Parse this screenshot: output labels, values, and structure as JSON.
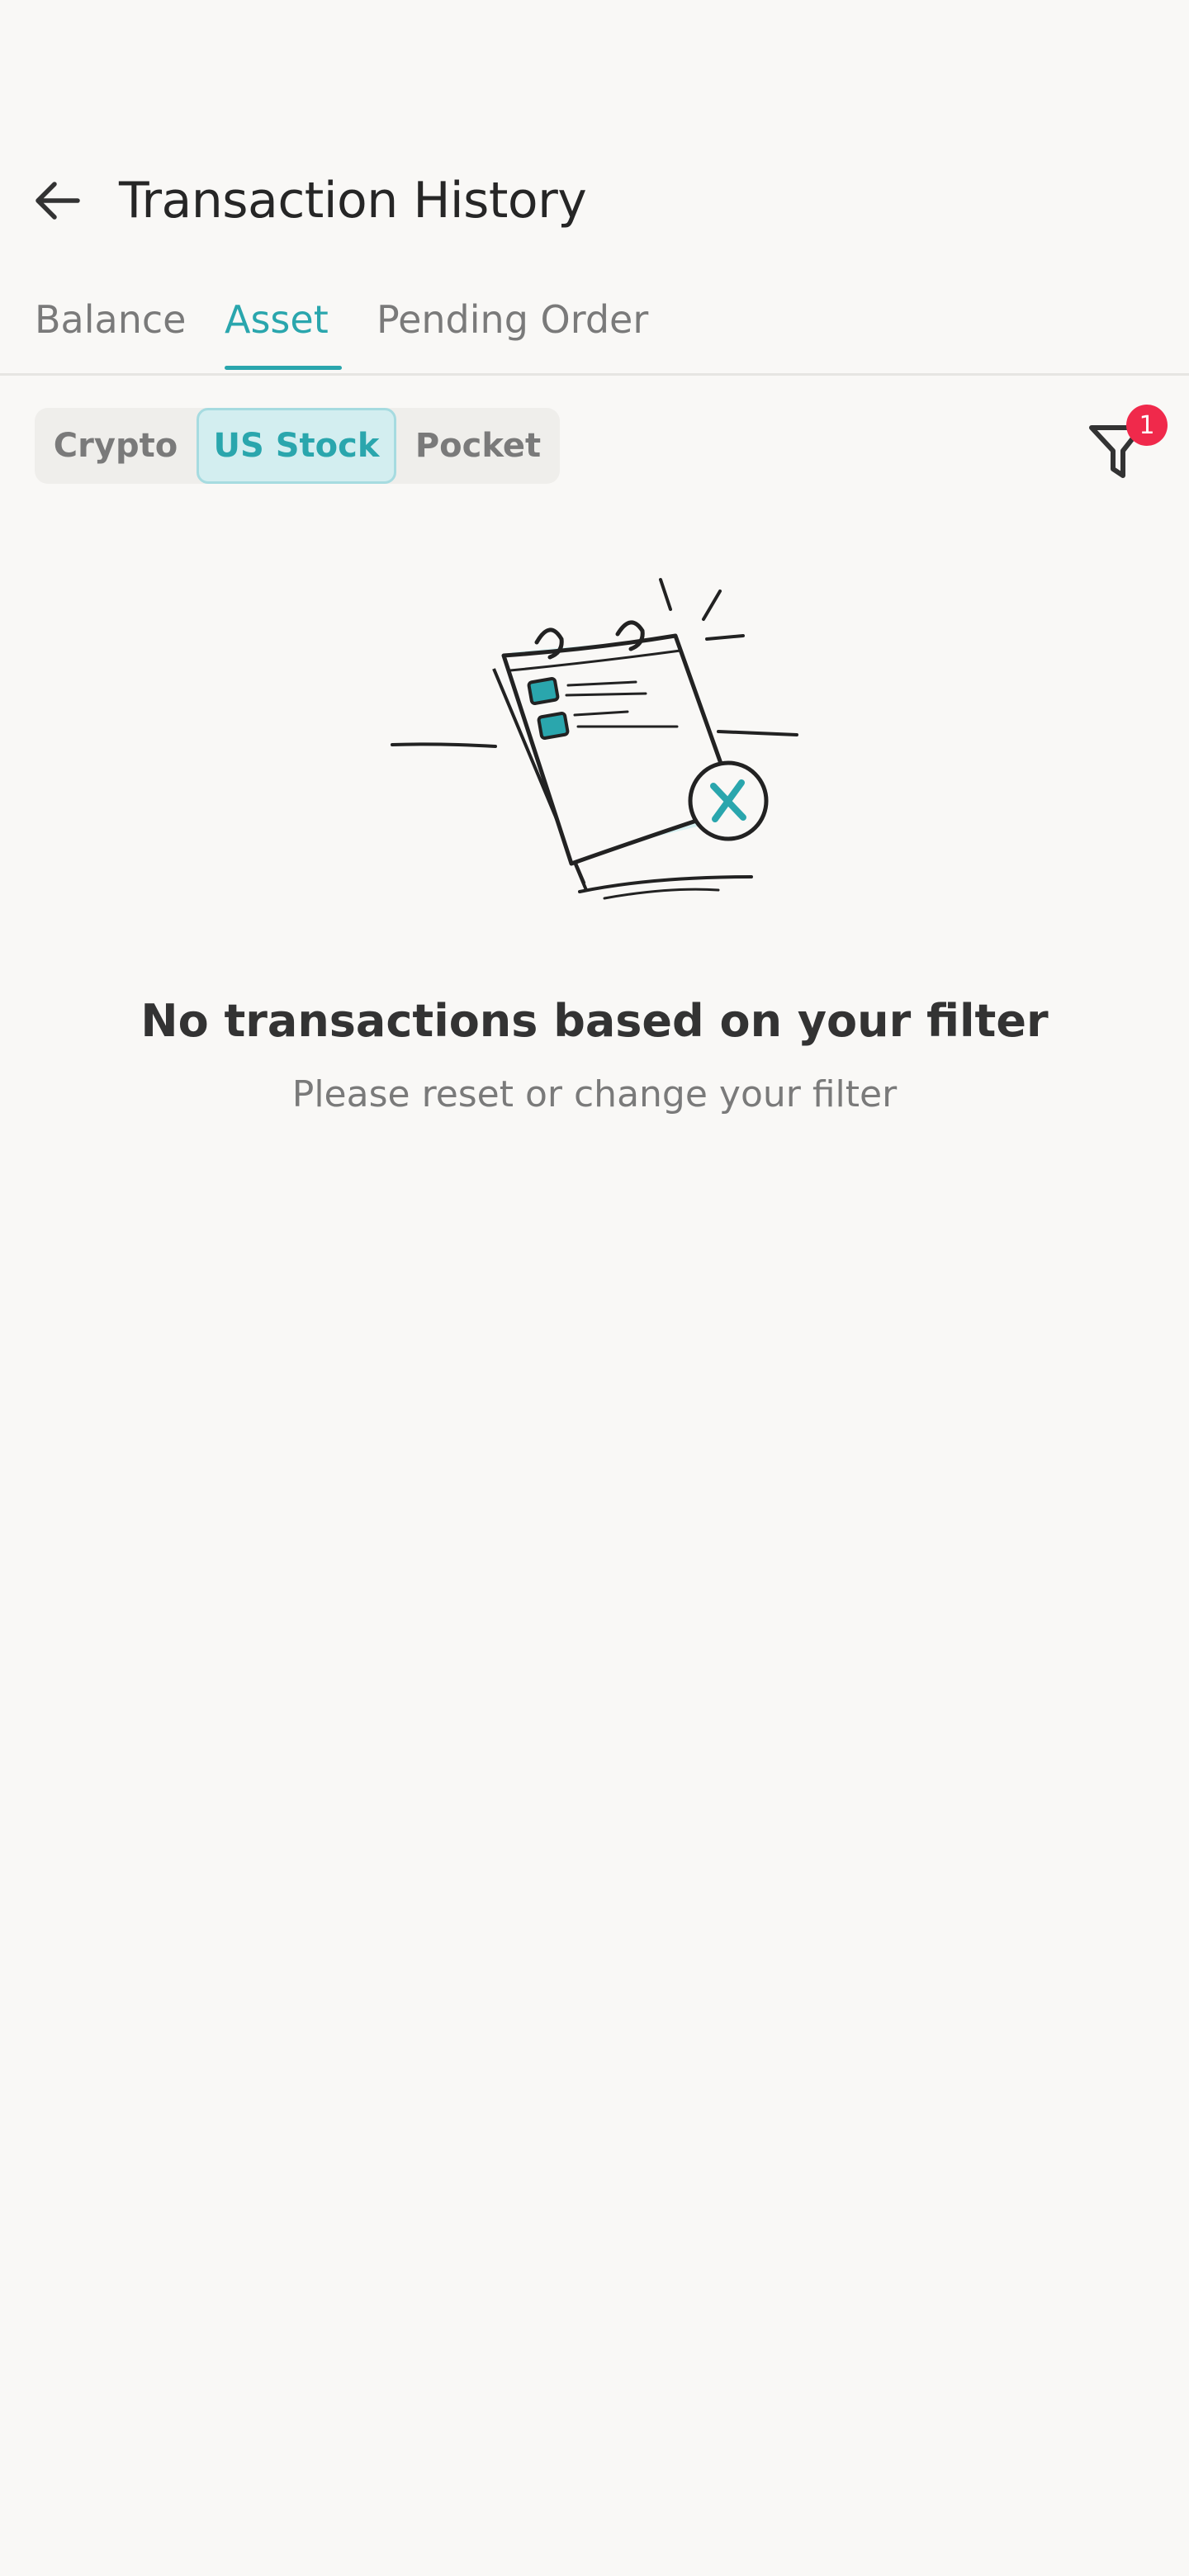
{
  "header": {
    "title": "Transaction History"
  },
  "tabs": [
    {
      "label": "Balance",
      "active": false
    },
    {
      "label": "Asset",
      "active": true
    },
    {
      "label": "Pending Order",
      "active": false
    }
  ],
  "asset_filter": {
    "options": [
      {
        "label": "Crypto",
        "active": false
      },
      {
        "label": "US Stock",
        "active": true
      },
      {
        "label": "Pocket",
        "active": false
      }
    ]
  },
  "filter": {
    "icon": "filter-icon",
    "badge_count": "1"
  },
  "empty_state": {
    "icon": "cancelled-calendar-illustration",
    "title": "No transactions based on your filter",
    "subtitle": "Please reset or change your filter"
  },
  "colors": {
    "accent": "#2aa6ad",
    "badge": "#f0294b",
    "background": "#f9f8f6"
  }
}
